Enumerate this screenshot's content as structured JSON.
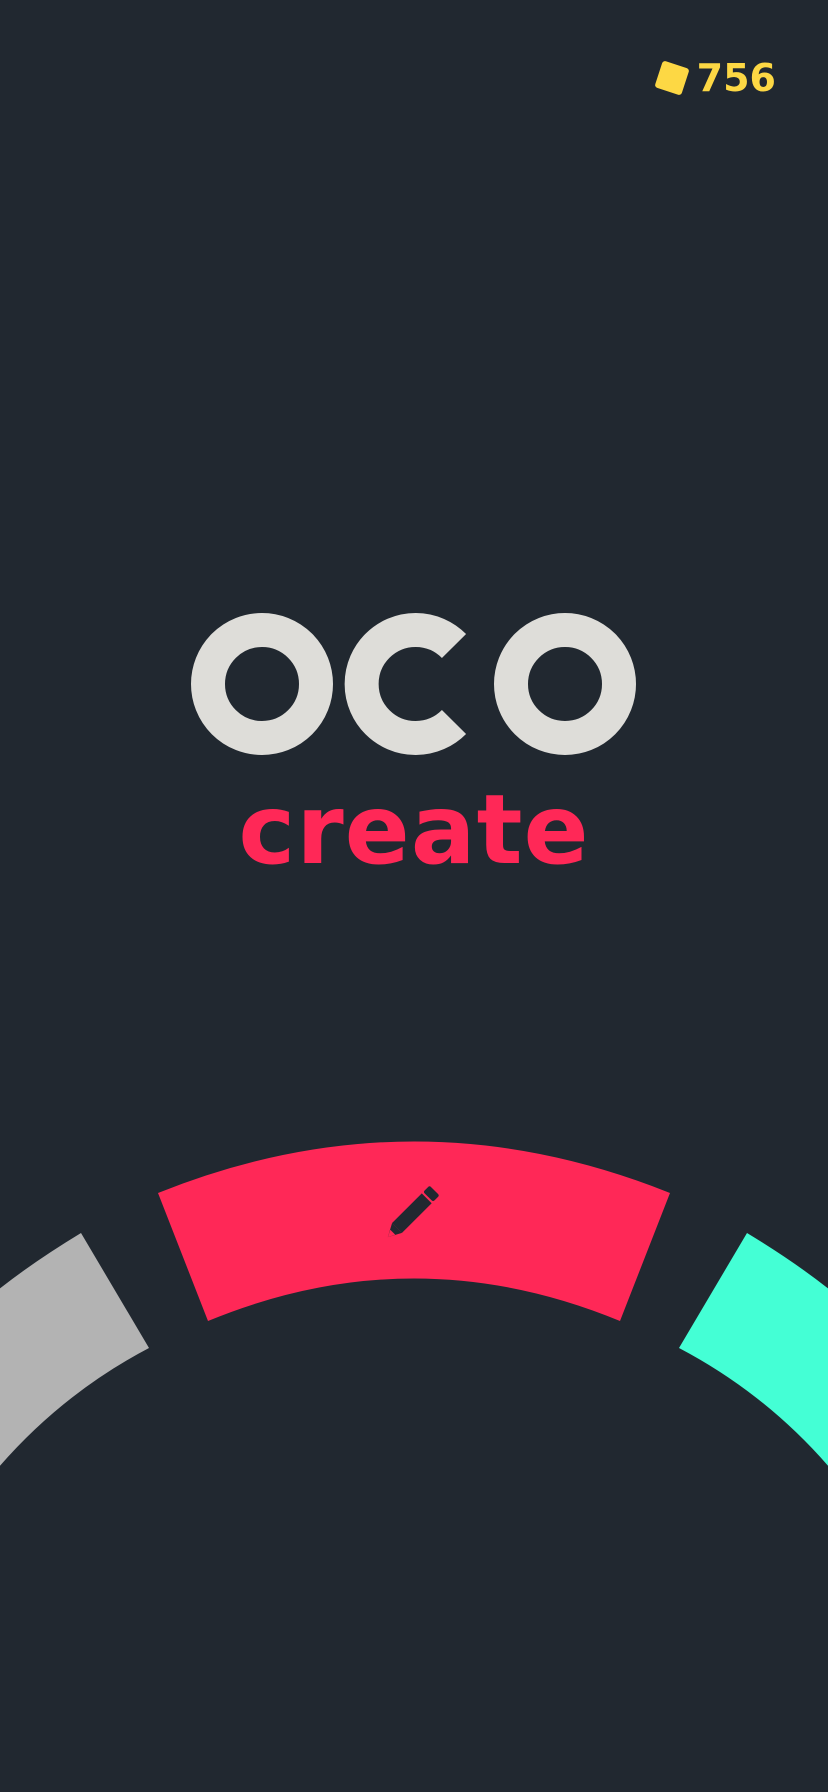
{
  "header": {
    "coin_count": "756",
    "coin_icon": "yellow-square-gem-icon",
    "coin_color": "#FDD844"
  },
  "title": {
    "logo_text": "OCO",
    "logo_color": "#DEDDD9",
    "mode_label": "create",
    "mode_color": "#FF2857"
  },
  "mode_wheel": {
    "segments": [
      {
        "name": "left-segment",
        "color": "#B3B3B3",
        "selected": false
      },
      {
        "name": "create-segment",
        "color": "#FF2857",
        "icon": "pencil-icon",
        "selected": true
      },
      {
        "name": "right-segment",
        "color": "#44FFD5",
        "selected": false
      }
    ]
  },
  "colors": {
    "background": "#212830",
    "icon_dark": "#212830"
  }
}
